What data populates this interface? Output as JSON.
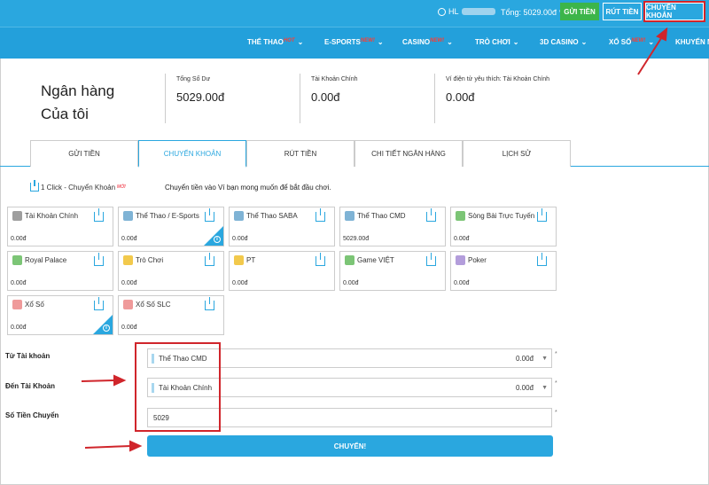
{
  "topbar": {
    "user_prefix": "HL",
    "total_label": "Tổng: 5029.00đ",
    "deposit_button": "GỬI TIỀN",
    "withdraw_button": "RÚT TIỀN",
    "transfer_button": "CHUYỂN KHOẢN"
  },
  "nav": [
    {
      "label": "THỂ THAO",
      "badge": "HOT"
    },
    {
      "label": "E-SPORTS",
      "badge": "NEW!"
    },
    {
      "label": "CASINO",
      "badge": "NEW!"
    },
    {
      "label": "TRÒ CHƠI",
      "badge": ""
    },
    {
      "label": "3D CASINO",
      "badge": ""
    },
    {
      "label": "XỔ SỐ",
      "badge": "NEW!"
    },
    {
      "label": "KHUYẾN M",
      "badge": ""
    }
  ],
  "header": {
    "title_line1": "Ngân hàng",
    "title_line2": "Của tôi",
    "summary": [
      {
        "label": "Tổng Số Dư",
        "value": "5029.00đ"
      },
      {
        "label": "Tài Khoản Chính",
        "value": "0.00đ"
      },
      {
        "label": "Ví điện tử yêu thích: Tài Khoản Chính",
        "value": "0.00đ"
      }
    ]
  },
  "tabs": [
    "GỬI TIỀN",
    "CHUYỂN KHOẢN",
    "RÚT TIỀN",
    "CHI TIẾT NGÂN HÀNG",
    "LỊCH SỬ"
  ],
  "active_tab": "CHUYỂN KHOẢN",
  "one_click": {
    "label": "1 Click - Chuyển Khoản",
    "badge": "MỚI"
  },
  "instruction": "Chuyển tiền vào Ví bạn mong muốn để bắt đầu chơi.",
  "wallets": [
    {
      "name": "Tài Khoản Chính",
      "value": "0.00đ",
      "icon_color": "#9e9e9e",
      "info": false
    },
    {
      "name": "Thể Thao / E-Sports",
      "value": "0.00đ",
      "icon_color": "#7fb3d5",
      "info": true
    },
    {
      "name": "Thể Thao SABA",
      "value": "0.00đ",
      "icon_color": "#7fb3d5",
      "info": false
    },
    {
      "name": "Thể Thao CMD",
      "value": "5029.00đ",
      "icon_color": "#7fb3d5",
      "info": false
    },
    {
      "name": "Sòng Bài Trực Tuyến",
      "value": "0.00đ",
      "icon_color": "#7cc576",
      "info": false
    },
    {
      "name": "Royal Palace",
      "value": "0.00đ",
      "icon_color": "#7cc576",
      "info": false
    },
    {
      "name": "Trò Chơi",
      "value": "0.00đ",
      "icon_color": "#f2c94c",
      "info": false
    },
    {
      "name": "PT",
      "value": "0.00đ",
      "icon_color": "#f2c94c",
      "info": false
    },
    {
      "name": "Game VIỆT",
      "value": "0.00đ",
      "icon_color": "#7cc576",
      "info": false
    },
    {
      "name": "Poker",
      "value": "0.00đ",
      "icon_color": "#b39ddb",
      "info": false
    },
    {
      "name": "Xổ Số",
      "value": "0.00đ",
      "icon_color": "#ef9a9a",
      "info": true
    },
    {
      "name": "Xổ Số SLC",
      "value": "0.00đ",
      "icon_color": "#ef9a9a",
      "info": false
    }
  ],
  "form": {
    "from_label": "Từ Tài khoản",
    "from_value": "Thể Thao CMD",
    "from_balance": "0.00đ",
    "to_label": "Đến Tài Khoản",
    "to_value": "Tài Khoản Chính",
    "to_balance": "0.00đ",
    "amount_label": "Số Tiền Chuyển",
    "amount_value": "5029",
    "submit_label": "CHUYỂN!"
  },
  "colors": {
    "primary": "#2aa7df",
    "green": "#3cb54a",
    "annotation": "#d0252b"
  }
}
